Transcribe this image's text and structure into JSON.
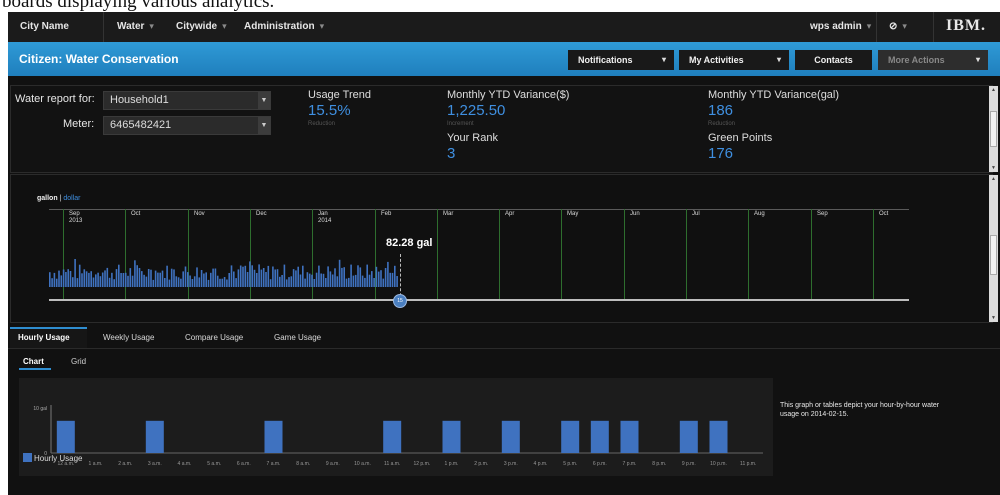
{
  "caption": "boards displaying various analytics.",
  "nav": {
    "city_name": "City Name",
    "water": "Water",
    "citywide": "Citywide",
    "administration": "Administration",
    "user": "wps admin",
    "help_icon": "help-icon",
    "logo": "IBM."
  },
  "titlebar": {
    "title": "Citizen: Water Conservation",
    "notifications": "Notifications",
    "my_activities": "My Activities",
    "contacts": "Contacts",
    "more_actions": "More Actions"
  },
  "summary": {
    "water_report_label": "Water report for:",
    "household": "Household1",
    "meter_label": "Meter:",
    "meter": "6465482421",
    "usage_trend_label": "Usage Trend",
    "usage_trend_value": "15.5%",
    "usage_trend_sub": "Reduction",
    "ytd_dollar_label": "Monthly YTD Variance($)",
    "ytd_dollar_value": "1,225.50",
    "ytd_dollar_sub": "Increment",
    "rank_label": "Your Rank",
    "rank_value": "3",
    "ytd_gal_label": "Monthly YTD Variance(gal)",
    "ytd_gal_value": "186",
    "ytd_gal_sub": "Reduction",
    "green_label": "Green Points",
    "green_value": "176"
  },
  "timeline": {
    "unit_gallon": "gallon",
    "unit_sep": "|",
    "unit_dollar": "dollar",
    "months": [
      {
        "label": "Sep",
        "year": "2013"
      },
      {
        "label": "Oct",
        "year": ""
      },
      {
        "label": "Nov",
        "year": ""
      },
      {
        "label": "Dec",
        "year": ""
      },
      {
        "label": "Jan",
        "year": "2014"
      },
      {
        "label": "Feb",
        "year": ""
      },
      {
        "label": "Mar",
        "year": ""
      },
      {
        "label": "Apr",
        "year": ""
      },
      {
        "label": "May",
        "year": ""
      },
      {
        "label": "Jun",
        "year": ""
      },
      {
        "label": "Jul",
        "year": ""
      },
      {
        "label": "Aug",
        "year": ""
      },
      {
        "label": "Sep",
        "year": ""
      },
      {
        "label": "Oct",
        "year": ""
      }
    ],
    "scrub_value": "82.28 gal",
    "scrub_knob": "15"
  },
  "tabs": {
    "hourly": "Hourly Usage",
    "weekly": "Weekly Usage",
    "compare": "Compare Usage",
    "game": "Game Usage",
    "chart": "Chart",
    "grid": "Grid"
  },
  "description": "This graph or tables depict your hour-by-hour water usage on 2014-02-15.",
  "colors": {
    "accent": "#2f8ed1",
    "bar": "#3f72c0",
    "month_line": "#2e6e2e",
    "value_text": "#3f8fe0"
  },
  "chart_data": {
    "type": "bar",
    "title": "",
    "xlabel": "",
    "ylabel": "",
    "ylim": [
      0,
      10
    ],
    "y_ticks": [
      "0",
      "10 gal"
    ],
    "categories": [
      "12 a.m.",
      "1 a.m.",
      "2 a.m.",
      "3 a.m.",
      "4 a.m.",
      "5 a.m.",
      "6 a.m.",
      "7 a.m.",
      "8 a.m.",
      "9 a.m.",
      "10 a.m.",
      "11 a.m.",
      "12 p.m.",
      "1 p.m.",
      "2 p.m.",
      "3 p.m.",
      "4 p.m.",
      "5 p.m.",
      "6 p.m.",
      "7 p.m.",
      "8 p.m.",
      "9 p.m.",
      "10 p.m.",
      "11 p.m."
    ],
    "series": [
      {
        "name": "Hourly Usage",
        "values": [
          7,
          0,
          0,
          7,
          0,
          0,
          0,
          7,
          0,
          0,
          0,
          7,
          0,
          7,
          0,
          7,
          0,
          7,
          7,
          7,
          0,
          7,
          7,
          0
        ]
      }
    ],
    "legend": "bottom-left"
  }
}
